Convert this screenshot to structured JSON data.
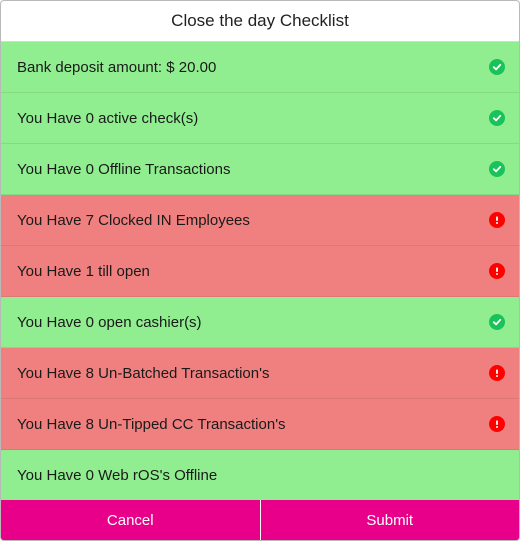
{
  "dialog": {
    "title": "Close the day Checklist"
  },
  "items": [
    {
      "label": "Bank deposit amount: $ 20.00",
      "status": "ok",
      "icon": "check-circle-icon"
    },
    {
      "label": "You Have 0 active check(s)",
      "status": "ok",
      "icon": "check-circle-icon"
    },
    {
      "label": "You Have 0 Offline Transactions",
      "status": "ok",
      "icon": "check-circle-icon"
    },
    {
      "label": "You Have 7 Clocked IN Employees",
      "status": "bad",
      "icon": "alert-icon"
    },
    {
      "label": "You Have 1 till open",
      "status": "bad",
      "icon": "alert-icon"
    },
    {
      "label": "You Have 0 open cashier(s)",
      "status": "ok",
      "icon": "check-circle-icon"
    },
    {
      "label": "You Have 8 Un-Batched Transaction's",
      "status": "bad",
      "icon": "alert-icon"
    },
    {
      "label": "You Have 8 Un-Tipped CC Transaction's",
      "status": "bad",
      "icon": "alert-icon"
    },
    {
      "label": "You Have 0 Web rOS's Offline",
      "status": "ok",
      "icon": ""
    }
  ],
  "footer": {
    "cancel_label": "Cancel",
    "submit_label": "Submit"
  },
  "colors": {
    "ok": "#90ee90",
    "bad": "#f08080",
    "button": "#e8008a",
    "check": "#19c35a",
    "alert": "#ff0000"
  }
}
